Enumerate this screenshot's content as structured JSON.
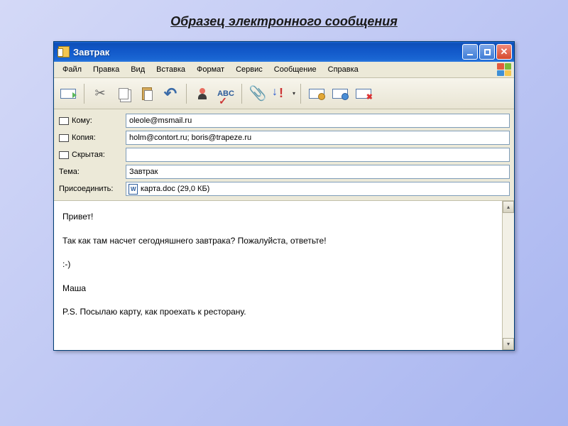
{
  "slide_title": "Образец электронного сообщения",
  "window": {
    "title": "Завтрак"
  },
  "menu": {
    "file": "Файл",
    "edit": "Правка",
    "view": "Вид",
    "insert": "Вставка",
    "format": "Формат",
    "tools": "Сервис",
    "message": "Сообщение",
    "help": "Справка"
  },
  "toolbar": {
    "send": "Отправить",
    "cut": "Вырезать",
    "copy": "Копировать",
    "paste": "Вставить",
    "undo": "Отменить",
    "check_names": "Проверить",
    "spell": "ABC",
    "attach": "Вложить",
    "priority": "Важность",
    "sign": "Подписать",
    "encrypt": "Зашифровать",
    "offline": "Автономно"
  },
  "fields": {
    "to_label": "Кому:",
    "to_value": "oleole@msmail.ru",
    "cc_label": "Копия:",
    "cc_value": "holm@contort.ru; boris@trapeze.ru",
    "bcc_label": "Скрытая:",
    "bcc_value": "",
    "subject_label": "Тема:",
    "subject_value": "Завтрак",
    "attach_label": "Присоединить:",
    "attach_value": "карта.doc (29,0 КБ)"
  },
  "body": "Привет!\n\nТак как там насчет сегодняшнего завтрака? Пожалуйста, ответьте!\n\n:-)\n\nМаша\n\nP.S. Посылаю карту, как проехать к ресторану."
}
